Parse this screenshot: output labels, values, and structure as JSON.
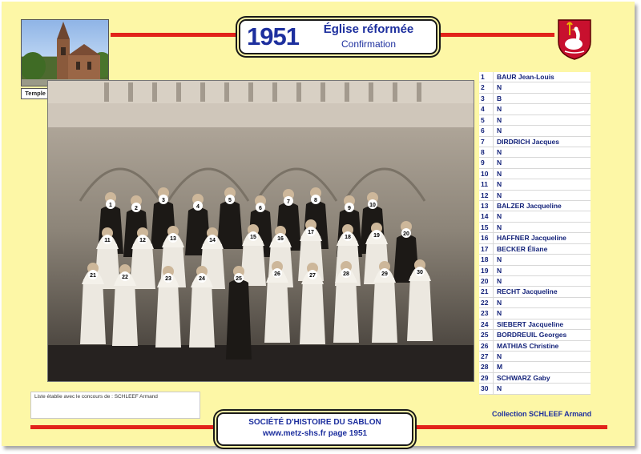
{
  "header": {
    "year": "1951",
    "title": "Église réformée",
    "subtitle": "Confirmation"
  },
  "church_photo": {
    "caption": "Temple de Montigny-Sablon"
  },
  "coat_of_arms": {
    "icon": "coat-of-arms-icon",
    "colors": [
      "#c8102e",
      "#ffffff",
      "#e8b800"
    ]
  },
  "group_photo": {
    "labels": [
      "1",
      "2",
      "3",
      "4",
      "5",
      "6",
      "7",
      "8",
      "9",
      "10",
      "11",
      "12",
      "13",
      "14",
      "15",
      "16",
      "17",
      "18",
      "19",
      "20",
      "21",
      "22",
      "23",
      "24",
      "25",
      "26",
      "27",
      "28",
      "29",
      "30"
    ]
  },
  "names": [
    {
      "num": "1",
      "name": "BAUR Jean-Louis"
    },
    {
      "num": "2",
      "name": "N"
    },
    {
      "num": "3",
      "name": "B"
    },
    {
      "num": "4",
      "name": "N"
    },
    {
      "num": "5",
      "name": "N"
    },
    {
      "num": "6",
      "name": "N"
    },
    {
      "num": "7",
      "name": "DIRDRICH Jacques"
    },
    {
      "num": "8",
      "name": "N"
    },
    {
      "num": "9",
      "name": "N"
    },
    {
      "num": "10",
      "name": "N"
    },
    {
      "num": "11",
      "name": "N"
    },
    {
      "num": "12",
      "name": "N"
    },
    {
      "num": "13",
      "name": "BALZER Jacqueline"
    },
    {
      "num": "14",
      "name": "N"
    },
    {
      "num": "15",
      "name": "N"
    },
    {
      "num": "16",
      "name": "HAFFNER Jacqueline"
    },
    {
      "num": "17",
      "name": "BECKER Éliane"
    },
    {
      "num": "18",
      "name": "N"
    },
    {
      "num": "19",
      "name": "N"
    },
    {
      "num": "20",
      "name": "N"
    },
    {
      "num": "21",
      "name": "RECHT Jacqueline"
    },
    {
      "num": "22",
      "name": "N"
    },
    {
      "num": "23",
      "name": "N"
    },
    {
      "num": "24",
      "name": "SIEBERT Jacqueline"
    },
    {
      "num": "25",
      "name": "BORDREUIL Georges"
    },
    {
      "num": "26",
      "name": "MATHIAS Christine"
    },
    {
      "num": "27",
      "name": "N"
    },
    {
      "num": "28",
      "name": "M"
    },
    {
      "num": "29",
      "name": "SCHWARZ Gaby"
    },
    {
      "num": "30",
      "name": "N"
    }
  ],
  "note": "Liste établie avec le concours de : SCHLEEF Armand",
  "collection": "Collection SCHLEEF Armand",
  "footer": {
    "society": "SOCIÉTÉ D'HISTOIRE DU SABLON",
    "url_page": "www.metz-shs.fr page 1951"
  },
  "colors": {
    "background": "#fdf7a6",
    "accent_red": "#e2231a",
    "text_blue": "#1d2f9e"
  }
}
